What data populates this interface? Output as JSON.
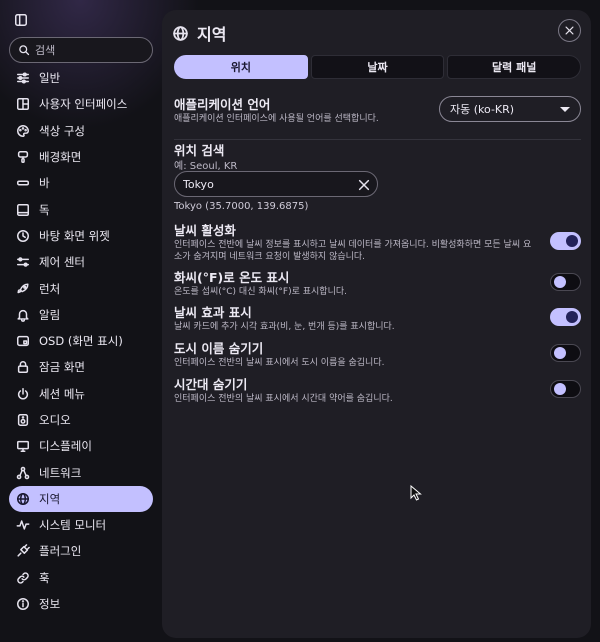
{
  "sidebar": {
    "search_placeholder": "검색",
    "items": [
      {
        "label": "일반",
        "icon": "sliders-icon"
      },
      {
        "label": "사용자 인터페이스",
        "icon": "layout-icon"
      },
      {
        "label": "색상 구성",
        "icon": "palette-icon"
      },
      {
        "label": "배경화면",
        "icon": "brush-icon"
      },
      {
        "label": "바",
        "icon": "bar-icon"
      },
      {
        "label": "독",
        "icon": "dock-icon"
      },
      {
        "label": "바탕 화면 위젯",
        "icon": "clock-icon"
      },
      {
        "label": "제어 센터",
        "icon": "controls-icon"
      },
      {
        "label": "런처",
        "icon": "rocket-icon"
      },
      {
        "label": "알림",
        "icon": "bell-icon"
      },
      {
        "label": "OSD (화면 표시)",
        "icon": "osd-icon"
      },
      {
        "label": "잠금 화면",
        "icon": "lock-icon"
      },
      {
        "label": "세션 메뉴",
        "icon": "power-icon"
      },
      {
        "label": "오디오",
        "icon": "speaker-icon"
      },
      {
        "label": "디스플레이",
        "icon": "monitor-icon"
      },
      {
        "label": "네트워크",
        "icon": "network-icon"
      },
      {
        "label": "지역",
        "icon": "globe-icon",
        "active": true
      },
      {
        "label": "시스템 모니터",
        "icon": "pulse-icon"
      },
      {
        "label": "플러그인",
        "icon": "plug-icon"
      },
      {
        "label": "훅",
        "icon": "link-icon"
      },
      {
        "label": "정보",
        "icon": "info-icon"
      }
    ]
  },
  "panel": {
    "title": "지역",
    "tabs": [
      {
        "label": "위치",
        "active": true
      },
      {
        "label": "날짜",
        "active": false
      },
      {
        "label": "달력 패널",
        "active": false
      }
    ],
    "language": {
      "title": "애플리케이션 언어",
      "desc": "애플리케이션 인터페이스에 사용될 언어를 선택합니다.",
      "selected": "자동 (ko-KR)"
    },
    "location": {
      "title": "위치 검색",
      "hint": "예: Seoul, KR",
      "value": "Tokyo",
      "coords": "Tokyo (35.7000, 139.6875)"
    },
    "toggles": [
      {
        "title": "날씨 활성화",
        "desc": "인터페이스 전반에 날씨 정보를 표시하고 날씨 데이터를 가져옵니다. 비활성화하면 모든 날씨 요소가 숨겨지며 네트워크 요청이 발생하지 않습니다.",
        "on": true
      },
      {
        "title": "화씨(°F)로 온도 표시",
        "desc": "온도를 섭씨(°C) 대신 화씨(°F)로 표시합니다.",
        "on": false
      },
      {
        "title": "날씨 효과 표시",
        "desc": "날씨 카드에 추가 시각 효과(비, 눈, 번개 등)를 표시합니다.",
        "on": true
      },
      {
        "title": "도시 이름 숨기기",
        "desc": "인터페이스 전반의 날씨 표시에서 도시 이름을 숨깁니다.",
        "on": false
      },
      {
        "title": "시간대 숨기기",
        "desc": "인터페이스 전반의 날씨 표시에서 시간대 약어를 숨깁니다.",
        "on": false
      }
    ]
  },
  "colors": {
    "accent": "#c3c0ff",
    "panel_bg": "#1f1e25",
    "page_bg": "#121217"
  }
}
